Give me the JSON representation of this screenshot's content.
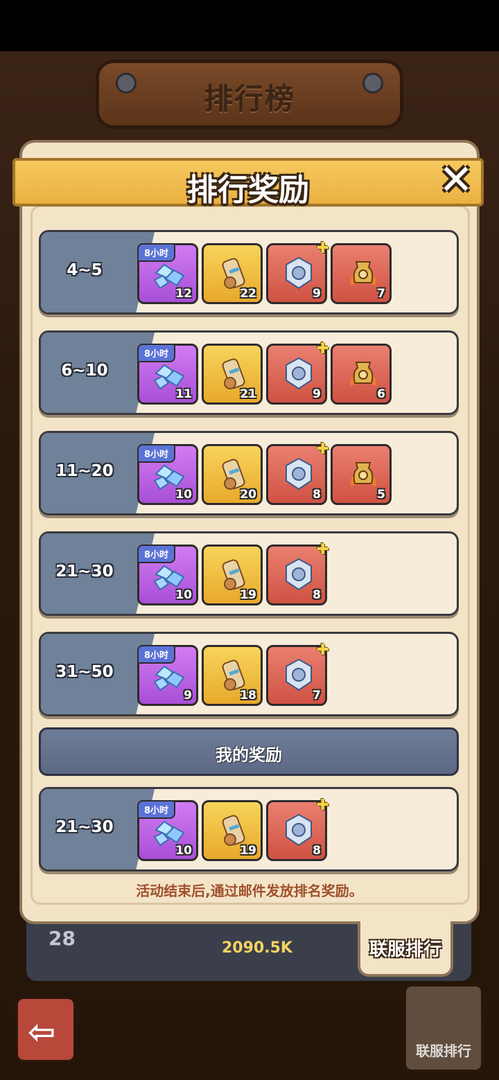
{
  "header": {
    "title": "排行榜"
  },
  "panel": {
    "title": "排行奖励",
    "close_glyph": "✕"
  },
  "rows": [
    {
      "rank": "4~5",
      "items": [
        {
          "type": "blue-crystals",
          "count": "12",
          "tag": "8小时"
        },
        {
          "type": "scroll",
          "count": "22"
        },
        {
          "type": "silver-medal",
          "count": "9"
        },
        {
          "type": "flame-urn",
          "count": "7"
        }
      ]
    },
    {
      "rank": "6~10",
      "items": [
        {
          "type": "blue-crystals",
          "count": "11",
          "tag": "8小时"
        },
        {
          "type": "scroll",
          "count": "21"
        },
        {
          "type": "silver-medal",
          "count": "9"
        },
        {
          "type": "flame-urn",
          "count": "6"
        }
      ]
    },
    {
      "rank": "11~20",
      "items": [
        {
          "type": "blue-crystals",
          "count": "10",
          "tag": "8小时"
        },
        {
          "type": "scroll",
          "count": "20"
        },
        {
          "type": "silver-medal",
          "count": "8"
        },
        {
          "type": "flame-urn",
          "count": "5"
        }
      ]
    },
    {
      "rank": "21~30",
      "items": [
        {
          "type": "blue-crystals",
          "count": "10",
          "tag": "8小时"
        },
        {
          "type": "scroll",
          "count": "19"
        },
        {
          "type": "silver-medal",
          "count": "8"
        }
      ]
    },
    {
      "rank": "31~50",
      "items": [
        {
          "type": "blue-crystals",
          "count": "9",
          "tag": "8小时"
        },
        {
          "type": "scroll",
          "count": "18"
        },
        {
          "type": "silver-medal",
          "count": "7"
        }
      ]
    }
  ],
  "my_reward": {
    "header": "我的奖励",
    "rank": "21~30",
    "items": [
      {
        "type": "blue-crystals",
        "count": "10",
        "tag": "8小时"
      },
      {
        "type": "scroll",
        "count": "19"
      },
      {
        "type": "silver-medal",
        "count": "8"
      }
    ]
  },
  "notice": "活动结束后,通过邮件发放排名奖励。",
  "cross_server_tab": "联服排行",
  "background": {
    "rank": "28",
    "power": "2090.5K",
    "cross_button": "联服排行",
    "back_glyph": "⇦"
  },
  "colors": {
    "rank_tab": "#6f8299",
    "banner": "#f6c95f",
    "panel": "#f3e4c8"
  }
}
